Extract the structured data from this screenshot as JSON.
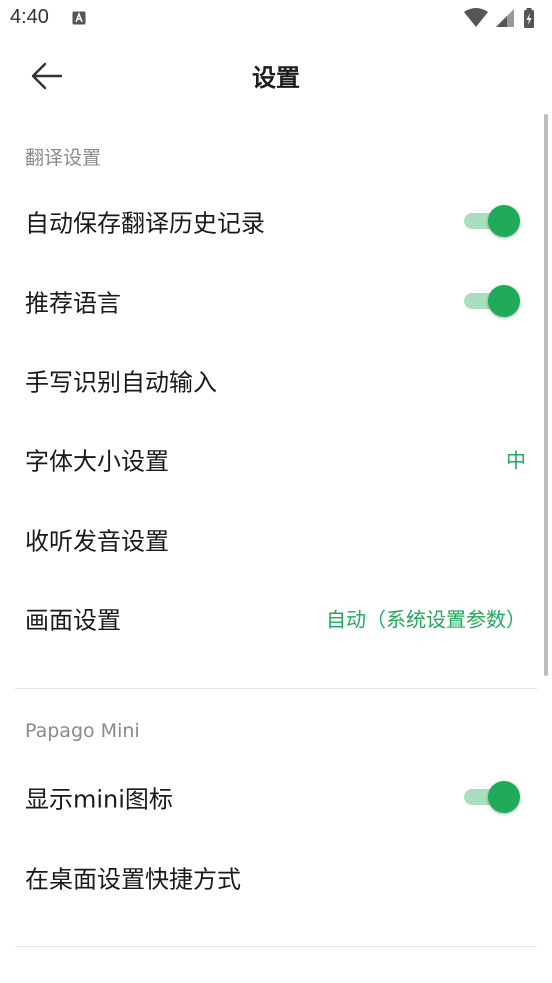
{
  "status_bar": {
    "time": "4:40",
    "notification_icon": "a-icon",
    "wifi_icon": "wifi-icon",
    "signal_icon": "signal-icon",
    "battery_icon": "battery-charging-icon"
  },
  "app_bar": {
    "back_icon": "arrow-left-icon",
    "title": "设置"
  },
  "sections": {
    "translation": {
      "header": "翻译设置",
      "items": {
        "auto_save_history": {
          "label": "自动保存翻译历史记录",
          "toggle_on": true
        },
        "recommend_language": {
          "label": "推荐语言",
          "toggle_on": true
        },
        "handwriting_auto_input": {
          "label": "手写识别自动输入"
        },
        "font_size": {
          "label": "字体大小设置",
          "value": "中"
        },
        "listen_pronunciation": {
          "label": "收听发音设置"
        },
        "screen_settings": {
          "label": "画面设置",
          "value": "自动（系统设置参数）"
        }
      }
    },
    "papago_mini": {
      "header": "Papago Mini",
      "items": {
        "show_mini_icon": {
          "label": "显示mini图标",
          "toggle_on": true
        },
        "desktop_shortcut": {
          "label": "在桌面设置快捷方式"
        }
      }
    }
  },
  "colors": {
    "accent": "#1faa5c",
    "toggle_track": "#a8dfbf",
    "section_header": "#8a8a8a",
    "divider": "#e2e2e2"
  }
}
